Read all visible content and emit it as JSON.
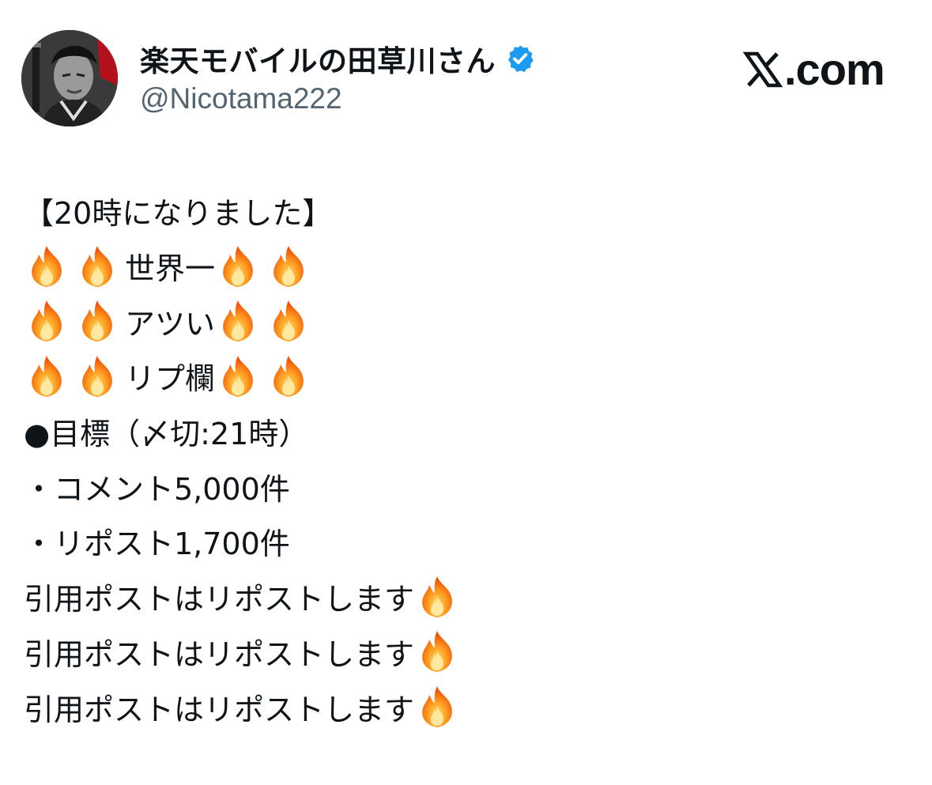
{
  "header": {
    "display_name": "楽天モバイルの田草川さん",
    "handle": "@Nicotama222",
    "verified": true,
    "site_label": ".com",
    "avatar": "samurai-portrait-avatar"
  },
  "post": {
    "line_1": "【20時になりました】",
    "line_2_text": "世界一",
    "line_3_text": "アツい",
    "line_4_text": "リプ欄",
    "line_5": "●目標（〆切:21時）",
    "line_6": "・コメント5,000件",
    "line_7": "・リポスト1,700件",
    "line_8": "引用ポストはリポストします",
    "line_9": "引用ポストはリポストします",
    "line_10": "引用ポストはリポストします",
    "emoji": "fire-emoji"
  },
  "colors": {
    "text": "#0f1419",
    "secondary": "#536471",
    "verified_blue": "#1d9bf0",
    "fire_outer": "#f4900c",
    "fire_inner": "#ffcc4d"
  }
}
